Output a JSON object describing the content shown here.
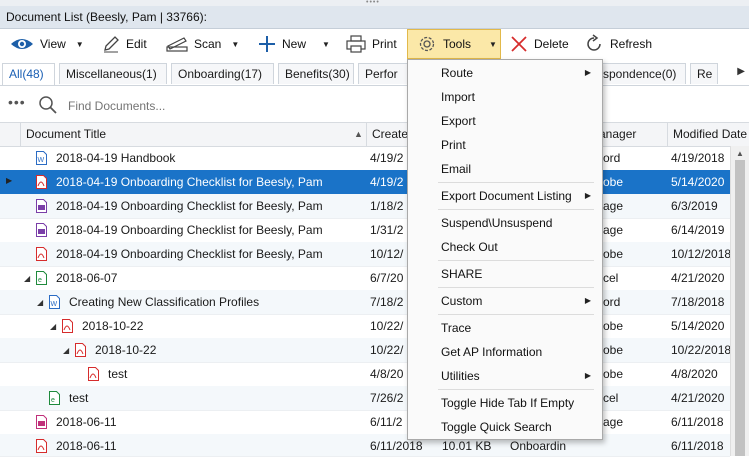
{
  "window": {
    "title": "Document List (Beesly, Pam | 33766):"
  },
  "toolbar": {
    "view": "View",
    "edit": "Edit",
    "scan": "Scan",
    "new": "New",
    "print": "Print",
    "tools": "Tools",
    "delete": "Delete",
    "refresh": "Refresh"
  },
  "tabs": [
    "All(48)",
    "Miscellaneous(1)",
    "Onboarding(17)",
    "Benefits(30)",
    "Perfor",
    "spondence(0)",
    "Re"
  ],
  "search": {
    "placeholder": "Find Documents..."
  },
  "columns": {
    "title": "Document Title",
    "created": "Create",
    "manager": "anager",
    "modified": "Modified Date"
  },
  "rows": [
    {
      "title": "2018-04-19 Handbook",
      "created": "4/19/2",
      "manager": "ord",
      "modified": "4/19/2018",
      "icon": "word-file-icon"
    },
    {
      "title": "2018-04-19 Onboarding Checklist for Beesly, Pam",
      "created": "4/19/2",
      "manager": "obe",
      "modified": "5/14/2020",
      "icon": "pdf-file-icon"
    },
    {
      "title": "2018-04-19 Onboarding Checklist for Beesly, Pam",
      "created": "1/18/2",
      "manager": "age",
      "modified": "6/3/2019",
      "icon": "image-file-icon"
    },
    {
      "title": "2018-04-19 Onboarding Checklist for Beesly, Pam",
      "created": "1/31/2",
      "manager": "age",
      "modified": "6/14/2019",
      "icon": "image-file-icon"
    },
    {
      "title": "2018-04-19 Onboarding Checklist for Beesly, Pam",
      "created": "10/12/",
      "manager": "obe",
      "modified": "10/12/2018",
      "icon": "pdf-file-icon"
    },
    {
      "title": "2018-06-07",
      "created": "6/7/20",
      "manager": "cel",
      "modified": "4/21/2020",
      "icon": "excel-file-icon"
    },
    {
      "title": "Creating New Classification Profiles",
      "created": "7/18/2",
      "manager": "ord",
      "modified": "7/18/2018",
      "icon": "word-file-icon"
    },
    {
      "title": "2018-10-22",
      "created": "10/22/",
      "manager": "obe",
      "modified": "5/14/2020",
      "icon": "pdf-file-icon"
    },
    {
      "title": "2018-10-22",
      "created": "10/22/",
      "manager": "obe",
      "modified": "10/22/2018",
      "icon": "pdf-file-icon"
    },
    {
      "title": "test",
      "created": "4/8/20",
      "manager": "obe",
      "modified": "4/8/2020",
      "icon": "pdf-file-icon"
    },
    {
      "title": "test",
      "created": "7/26/2",
      "manager": "cel",
      "modified": "4/21/2020",
      "icon": "excel-file-icon"
    },
    {
      "title": "2018-06-11",
      "created": "6/11/2",
      "manager": "age",
      "modified": "6/11/2018",
      "icon": "image-file-icon"
    },
    {
      "title": "2018-06-11",
      "created": "6/11/2018",
      "manager": "Onboardin",
      "modified": "6/11/2018",
      "size": "10.01 KB",
      "icon": "pdf-file-icon"
    }
  ],
  "tools_menu": {
    "route": "Route",
    "import": "Import",
    "export": "Export",
    "print": "Print",
    "email": "Email",
    "export_listing": "Export Document Listing",
    "suspend": "Suspend\\Unsuspend",
    "checkout": "Check Out",
    "share": "SHARE",
    "custom": "Custom",
    "trace": "Trace",
    "ap_info": "Get AP Information",
    "utilities": "Utilities",
    "toggle_hide_tab": "Toggle Hide Tab If Empty",
    "toggle_quick_search": "Toggle Quick Search"
  },
  "colors": {
    "selection": "#1a73c8",
    "tools_highlight": "#fbe8a8",
    "tab_active_text": "#1a5fb4"
  }
}
